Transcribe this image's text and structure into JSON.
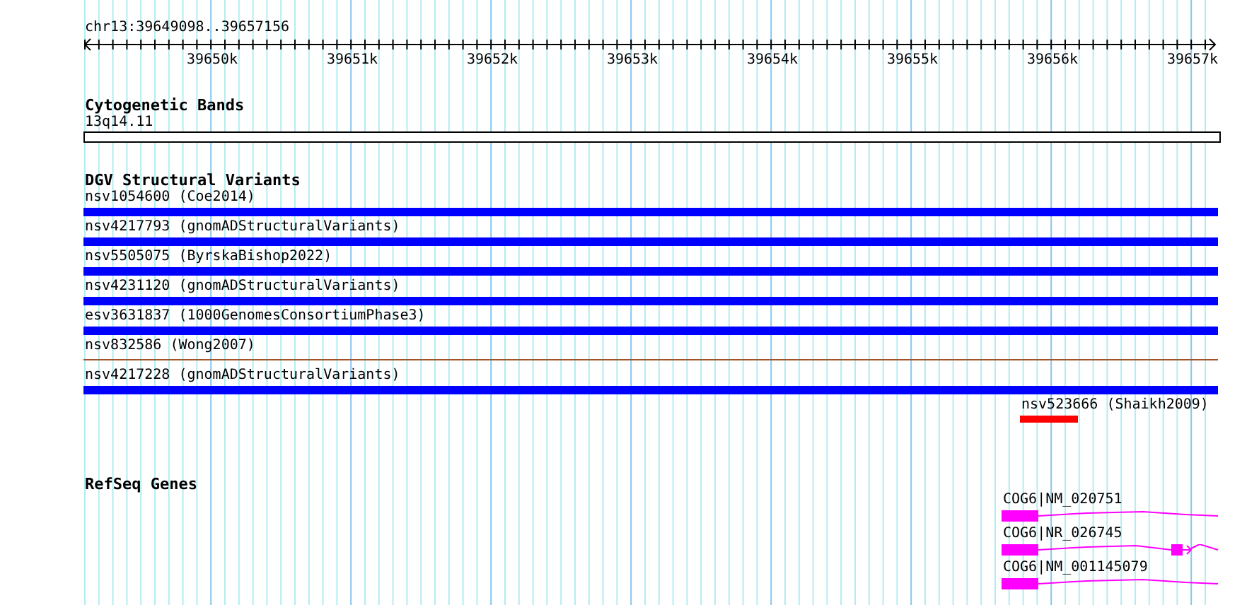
{
  "location": "chr13:39649098..39657156",
  "ruler": {
    "ticks": [
      "39650k",
      "39651k",
      "39652k",
      "39653k",
      "39654k",
      "39655k",
      "39656k",
      "39657k"
    ]
  },
  "tracks": [
    {
      "title": "Cytogenetic Bands",
      "kind": "bands",
      "features": [
        {
          "label": "13q14.11",
          "kind": "band"
        }
      ]
    },
    {
      "title": "DGV Structural Variants",
      "kind": "variants",
      "features": [
        {
          "label": "nsv1054600 (Coe2014)",
          "kind": "bar",
          "color": "#0000ff"
        },
        {
          "label": "nsv4217793 (gnomADStructuralVariants)",
          "kind": "bar",
          "color": "#0000ff"
        },
        {
          "label": "nsv5505075 (ByrskaBishop2022)",
          "kind": "bar",
          "color": "#0000ff"
        },
        {
          "label": "nsv4231120 (gnomADStructuralVariants)",
          "kind": "bar",
          "color": "#0000ff"
        },
        {
          "label": "esv3631837 (1000GenomesConsortiumPhase3)",
          "kind": "bar",
          "color": "#0000ff"
        },
        {
          "label": "nsv832586 (Wong2007)",
          "kind": "line",
          "color": "#a0522d"
        },
        {
          "label": "nsv4217228 (gnomADStructuralVariants)",
          "kind": "bar",
          "color": "#0000ff"
        },
        {
          "label": "nsv523666 (Shaikh2009)",
          "kind": "short",
          "color": "#ff0000"
        }
      ]
    },
    {
      "title": "RefSeq Genes",
      "kind": "genes",
      "features": [
        {
          "label": "COG6|NM_020751",
          "kind": "plain"
        },
        {
          "label": "COG6|NR_026745",
          "kind": "extra-exon"
        },
        {
          "label": "COG6|NM_001145079",
          "kind": "plain"
        }
      ]
    }
  ]
}
